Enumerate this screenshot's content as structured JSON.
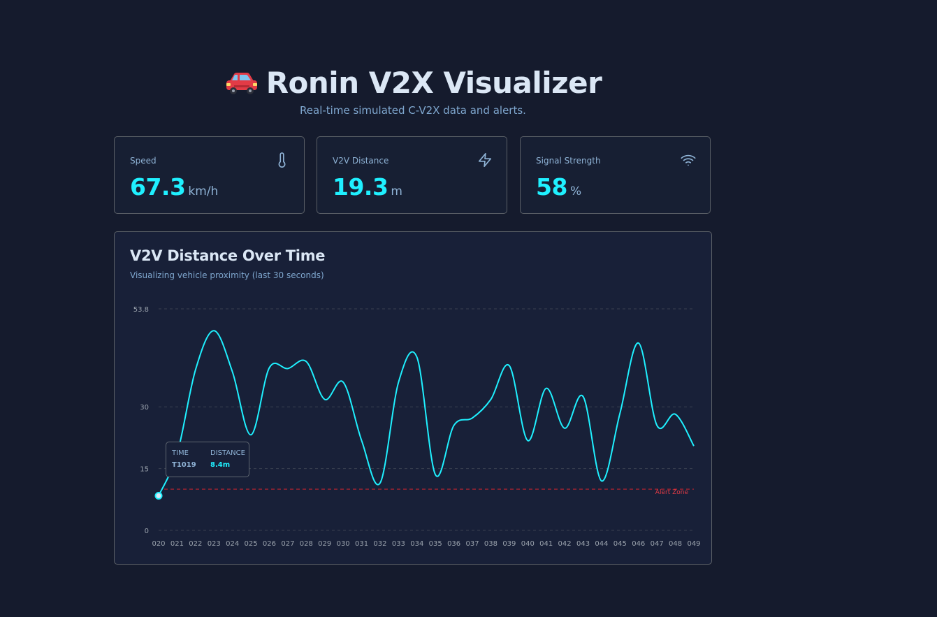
{
  "header": {
    "title": "Ronin V2X Visualizer",
    "subtitle": "Real-time simulated C-V2X data and alerts."
  },
  "cards": [
    {
      "label": "Speed",
      "value": "67.3",
      "unit": "km/h",
      "icon": "thermometer-icon"
    },
    {
      "label": "V2V Distance",
      "value": "19.3",
      "unit": "m",
      "icon": "lightning-icon"
    },
    {
      "label": "Signal Strength",
      "value": "58",
      "unit": "%",
      "icon": "wifi-icon"
    }
  ],
  "colors": {
    "background": "#151b2d",
    "accent": "#1ff0ff",
    "alert": "#c0242f",
    "muted": "#8fb3d6"
  },
  "chart": {
    "title": "V2V Distance Over Time",
    "subtitle": "Visualizing vehicle proximity (last 30 seconds)",
    "alert_label": "Alert Zone",
    "tooltip": {
      "time_header": "TIME",
      "distance_header": "DISTANCE",
      "time_value": "T1019",
      "distance_value": "8.4m"
    }
  },
  "chart_data": {
    "type": "line",
    "x": [
      "020",
      "021",
      "022",
      "023",
      "024",
      "025",
      "026",
      "027",
      "028",
      "029",
      "030",
      "031",
      "032",
      "033",
      "034",
      "035",
      "036",
      "037",
      "038",
      "039",
      "040",
      "041",
      "042",
      "043",
      "044",
      "045",
      "046",
      "047",
      "048",
      "049"
    ],
    "series": [
      {
        "values": [
          8.4,
          18.5,
          39,
          48.5,
          38.5,
          23.2,
          39.5,
          39.3,
          41,
          31.8,
          36,
          21.8,
          11.5,
          36,
          42,
          13.5,
          25.5,
          27.3,
          31.8,
          40,
          21.8,
          34.5,
          24.8,
          32.5,
          12,
          28.5,
          45.5,
          25.5,
          28.2,
          20.5
        ]
      }
    ],
    "yticks": [
      0,
      15,
      30,
      53.8
    ],
    "ylim": [
      0,
      53.8
    ],
    "alert_threshold": 10,
    "grid": true,
    "highlight_index": 0
  }
}
